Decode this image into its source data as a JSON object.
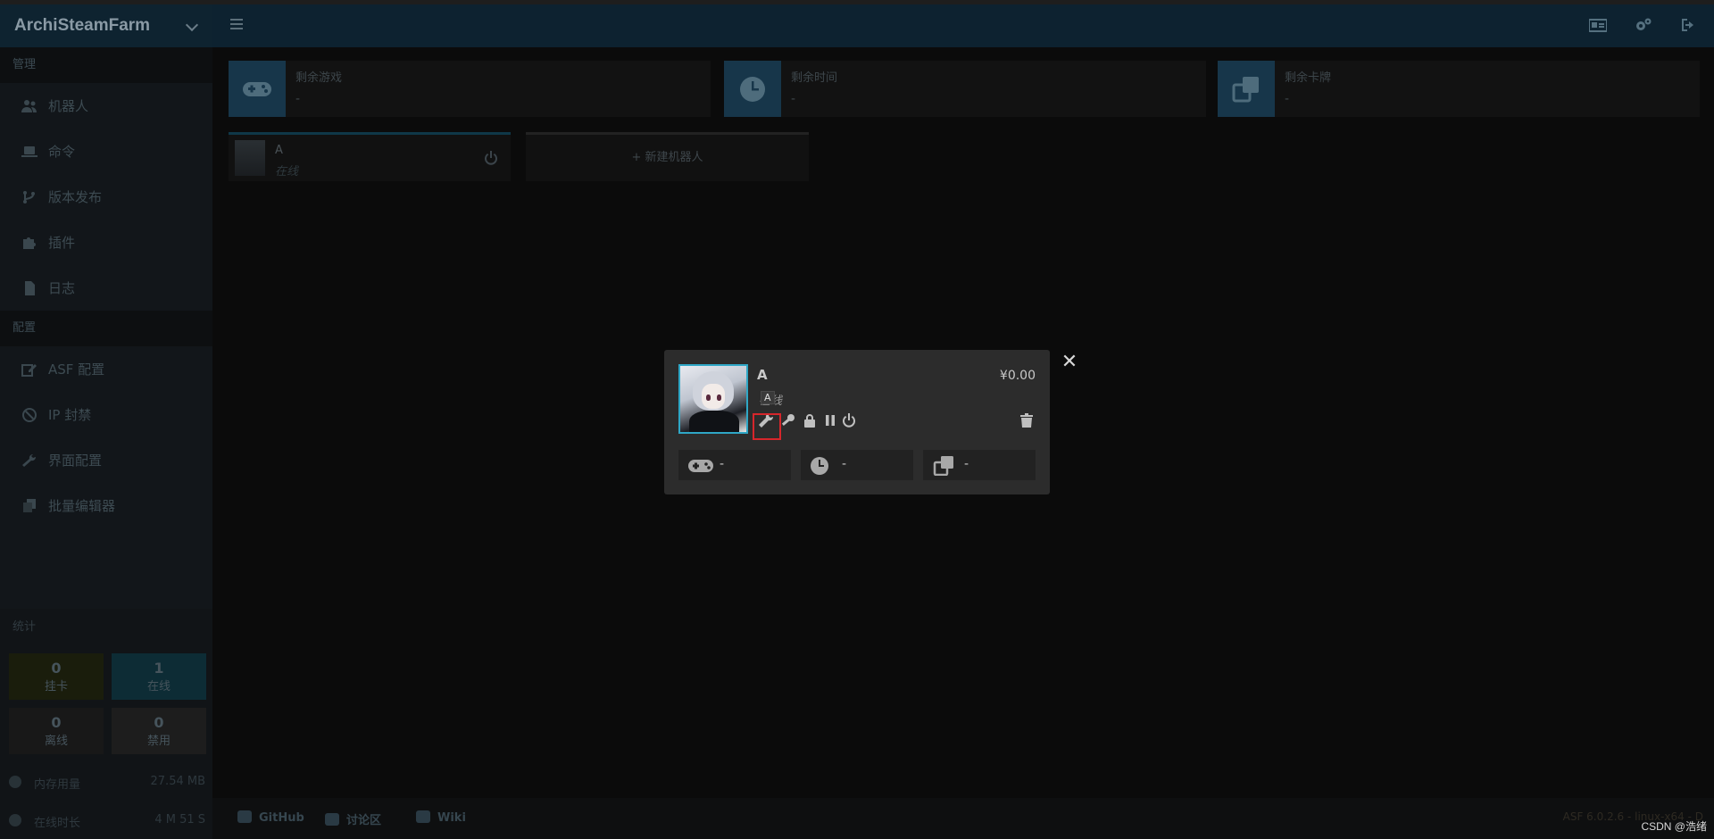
{
  "app": {
    "title": "ArchiSteamFarm"
  },
  "sidebar": {
    "manage_header": "管理",
    "manage_items": [
      {
        "label": "机器人",
        "icon": "users-icon"
      },
      {
        "label": "命令",
        "icon": "laptop-icon"
      },
      {
        "label": "版本发布",
        "icon": "branch-icon"
      },
      {
        "label": "插件",
        "icon": "puzzle-icon"
      },
      {
        "label": "日志",
        "icon": "file-icon"
      }
    ],
    "config_header": "配置",
    "config_items": [
      {
        "label": "ASF 配置",
        "icon": "edit-icon"
      },
      {
        "label": "IP 封禁",
        "icon": "ban-icon"
      },
      {
        "label": "界面配置",
        "icon": "wrench-icon"
      },
      {
        "label": "批量编辑器",
        "icon": "copy-icon"
      }
    ],
    "stats_header": "统计",
    "stats": [
      {
        "value": "0",
        "label": "挂卡",
        "color": "#1a1d0c"
      },
      {
        "value": "1",
        "label": "在线",
        "color": "#0d2c35"
      },
      {
        "value": "0",
        "label": "离线",
        "color": "#181818"
      },
      {
        "value": "0",
        "label": "禁用",
        "color": "#1d1d1d"
      }
    ],
    "memory": {
      "label": "内存用量",
      "value": "27.54 MB"
    },
    "uptime": {
      "label": "在线时长",
      "value": "4 M 51 S"
    }
  },
  "cards": [
    {
      "label": "剩余游戏",
      "value": "-",
      "icon": "gamepad-icon"
    },
    {
      "label": "剩余时间",
      "value": "-",
      "icon": "clock-icon"
    },
    {
      "label": "剩余卡牌",
      "value": "-",
      "icon": "cards-icon"
    }
  ],
  "bot_tile": {
    "name": "A",
    "status": "在线"
  },
  "add_bot": {
    "label": "+ 新建机器人"
  },
  "footer": {
    "links": [
      {
        "label": "GitHub"
      },
      {
        "label": "讨论区"
      },
      {
        "label": "Wiki"
      }
    ],
    "version": "ASF 6.0.2.6 - linux-x64 - D"
  },
  "modal": {
    "name": "A",
    "status": "在线",
    "tooltip": "A",
    "balance": "¥0.00",
    "stats": [
      {
        "value": "-",
        "icon": "gamepad-icon"
      },
      {
        "value": "-",
        "icon": "clock-icon"
      },
      {
        "value": "-",
        "icon": "cards-icon"
      }
    ]
  },
  "watermark": "CSDN @浩绪"
}
